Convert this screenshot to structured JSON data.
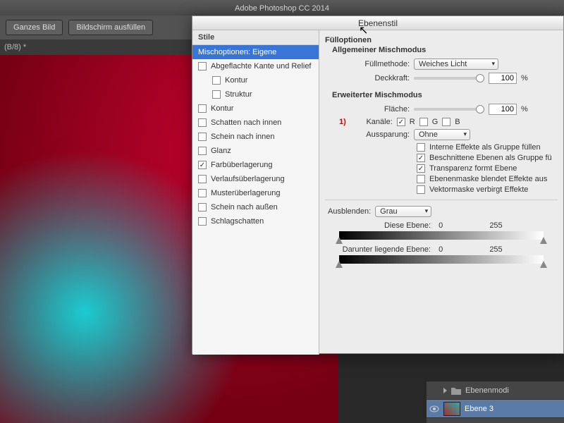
{
  "app_title": "Adobe Photoshop CC 2014",
  "toolbar": {
    "fit_screen": "Ganzes Bild",
    "fill_screen": "Bildschirm ausfüllen"
  },
  "tab": "(B/8) *",
  "dialog": {
    "title": "Ebenenstil",
    "styles_header": "Stile",
    "styles": [
      {
        "label": "Mischoptionen: Eigene",
        "selected": true,
        "checkbox": false
      },
      {
        "label": "Abgeflachte Kante und Relief",
        "checked": false
      },
      {
        "label": "Kontur",
        "checked": false,
        "sub": true
      },
      {
        "label": "Struktur",
        "checked": false,
        "sub": true
      },
      {
        "label": "Kontur",
        "checked": false
      },
      {
        "label": "Schatten nach innen",
        "checked": false
      },
      {
        "label": "Schein nach innen",
        "checked": false
      },
      {
        "label": "Glanz",
        "checked": false
      },
      {
        "label": "Farbüberlagerung",
        "checked": true
      },
      {
        "label": "Verlaufsüberlagerung",
        "checked": false
      },
      {
        "label": "Musterüberlagerung",
        "checked": false
      },
      {
        "label": "Schein nach außen",
        "checked": false
      },
      {
        "label": "Schlagschatten",
        "checked": false
      }
    ],
    "fill_options": "Fülloptionen",
    "general_blend": "Allgemeiner Mischmodus",
    "blend_mode_label": "Füllmethode:",
    "blend_mode": "Weiches Licht",
    "opacity_label": "Deckkraft:",
    "opacity_value": "100",
    "percent": "%",
    "advanced_blend": "Erweiterter Mischmodus",
    "fill_label": "Fläche:",
    "fill_value": "100",
    "annotation": "1)",
    "channels_label": "Kanäle:",
    "ch_r": "R",
    "ch_g": "G",
    "ch_b": "B",
    "ch_r_on": true,
    "ch_g_on": false,
    "ch_b_on": false,
    "knockout_label": "Aussparung:",
    "knockout_value": "Ohne",
    "adv_opts": [
      {
        "label": "Interne Effekte als Gruppe füllen",
        "checked": false
      },
      {
        "label": "Beschnittene Ebenen als Gruppe fü",
        "checked": true
      },
      {
        "label": "Transparenz formt Ebene",
        "checked": true
      },
      {
        "label": "Ebenenmaske blendet Effekte aus",
        "checked": false
      },
      {
        "label": "Vektormaske verbirgt Effekte",
        "checked": false
      }
    ],
    "blendif_label": "Ausblenden:",
    "blendif_value": "Grau",
    "this_layer": "Diese Ebene:",
    "under_layer": "Darunter liegende Ebene:",
    "range_min": "0",
    "range_max": "255"
  },
  "layers": {
    "group": "Ebenenmodi",
    "layer": "Ebene 3"
  }
}
